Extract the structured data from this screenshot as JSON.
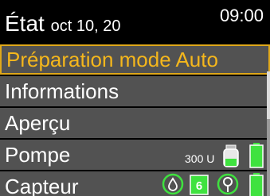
{
  "header": {
    "title": "État",
    "date": "oct 10, 20",
    "time": "09:00"
  },
  "menu": {
    "items": [
      {
        "label": "Préparation mode Auto"
      },
      {
        "label": "Informations"
      },
      {
        "label": "Aperçu"
      },
      {
        "label": "Pompe"
      },
      {
        "label": "Capteur"
      }
    ]
  },
  "pump_status": {
    "reservoir": "300 U",
    "battery_level": 1.0
  },
  "sensor_status": {
    "calibration_days": "6",
    "battery_level": 1.0
  },
  "colors": {
    "accent": "#f5b71c",
    "row_bg": "#525252",
    "status_green": "#3fe23f"
  }
}
